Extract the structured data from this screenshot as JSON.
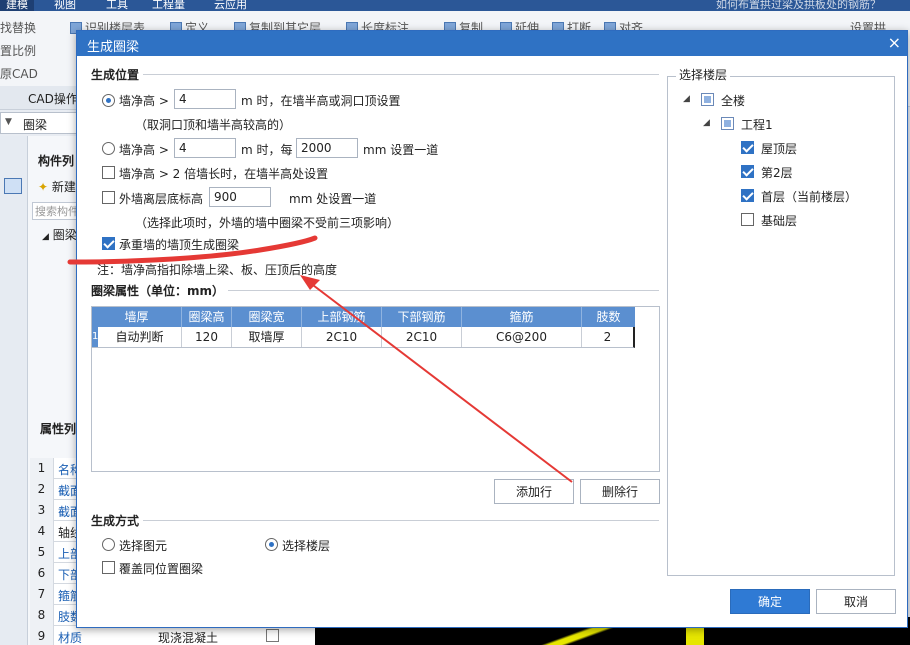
{
  "app": {
    "menu": [
      "建模",
      "视图",
      "工具",
      "工程量",
      "云应用"
    ],
    "help_search": "如何布置拱过梁及拱板处的钢筋？",
    "ribbon_items": [
      "找替换",
      "识别楼层表",
      "定义",
      "复制到其它层",
      "长度标注",
      "复制",
      "延伸",
      "打断",
      "对齐",
      "设置拱",
      "置比例",
      "原CAD"
    ],
    "cad_tab": "CAD操作",
    "component_combo": "圈梁",
    "left_panel": {
      "title": "构件列",
      "new_btn": "新建",
      "search_placeholder": "搜索构件",
      "tree_root": "圈梁"
    },
    "props": {
      "title": "属性列",
      "rows": [
        {
          "idx": "1",
          "name": "名称",
          "value": ""
        },
        {
          "idx": "2",
          "name": "截面",
          "value": ""
        },
        {
          "idx": "3",
          "name": "截面",
          "value": ""
        },
        {
          "idx": "4",
          "name": "轴线",
          "value": ""
        },
        {
          "idx": "5",
          "name": "上部",
          "value": ""
        },
        {
          "idx": "6",
          "name": "下部",
          "value": ""
        },
        {
          "idx": "7",
          "name": "箍筋",
          "value": ""
        },
        {
          "idx": "8",
          "name": "肢数",
          "value": ""
        },
        {
          "idx": "9",
          "name": "材质",
          "value": "现浇混凝土"
        }
      ]
    }
  },
  "dialog": {
    "title": "生成圈梁",
    "position_group": "生成位置",
    "opt1": {
      "label_pre": "墙净高 >",
      "value": "4",
      "label_post": "m 时，在墙半高或洞口顶设置",
      "note": "（取洞口顶和墙半高较高的）"
    },
    "opt2": {
      "label_pre": "墙净高 >",
      "value": "4",
      "label_mid": "m 时，每",
      "value2": "2000",
      "label_post": "mm 设置一道"
    },
    "opt3": {
      "label": "墙净高 > 2 倍墙长时，在墙半高处设置"
    },
    "opt4": {
      "label_pre": "外墙离层底标高",
      "value": "900",
      "label_post": "mm 处设置一道",
      "note": "（选择此项时，外墙的墙中圈梁不受前三项影响）"
    },
    "opt5": {
      "label": "承重墙的墙顶生成圈梁"
    },
    "footnote": "注：墙净高指扣除墙上梁、板、压顶后的高度",
    "props_group": "圈梁属性（单位：mm）",
    "table": {
      "headers": [
        "墙厚",
        "圈梁高",
        "圈梁宽",
        "上部钢筋",
        "下部钢筋",
        "箍筋",
        "肢数"
      ],
      "rows": [
        {
          "idx": "1",
          "cells": [
            "自动判断",
            "120",
            "取墙厚",
            "2C10",
            "2C10",
            "C6@200",
            "2"
          ]
        }
      ]
    },
    "add_row": "添加行",
    "delete_row": "删除行",
    "method_group": "生成方式",
    "method_select_element": "选择图元",
    "method_select_floor": "选择楼层",
    "overwrite": "覆盖同位置圈梁",
    "floor_group": "选择楼层",
    "floors": {
      "all": "全楼",
      "project": "工程1",
      "items": [
        {
          "name": "屋顶层",
          "checked": true
        },
        {
          "name": "第2层",
          "checked": true
        },
        {
          "name": "首层（当前楼层）",
          "checked": true
        },
        {
          "name": "基础层",
          "checked": false
        }
      ]
    },
    "ok": "确定",
    "cancel": "取消"
  },
  "colors": {
    "title_bar": "#2f72c4",
    "table_header": "#5b8fd0",
    "primary_button": "#2f7ad4",
    "annotation": "#e53935"
  }
}
